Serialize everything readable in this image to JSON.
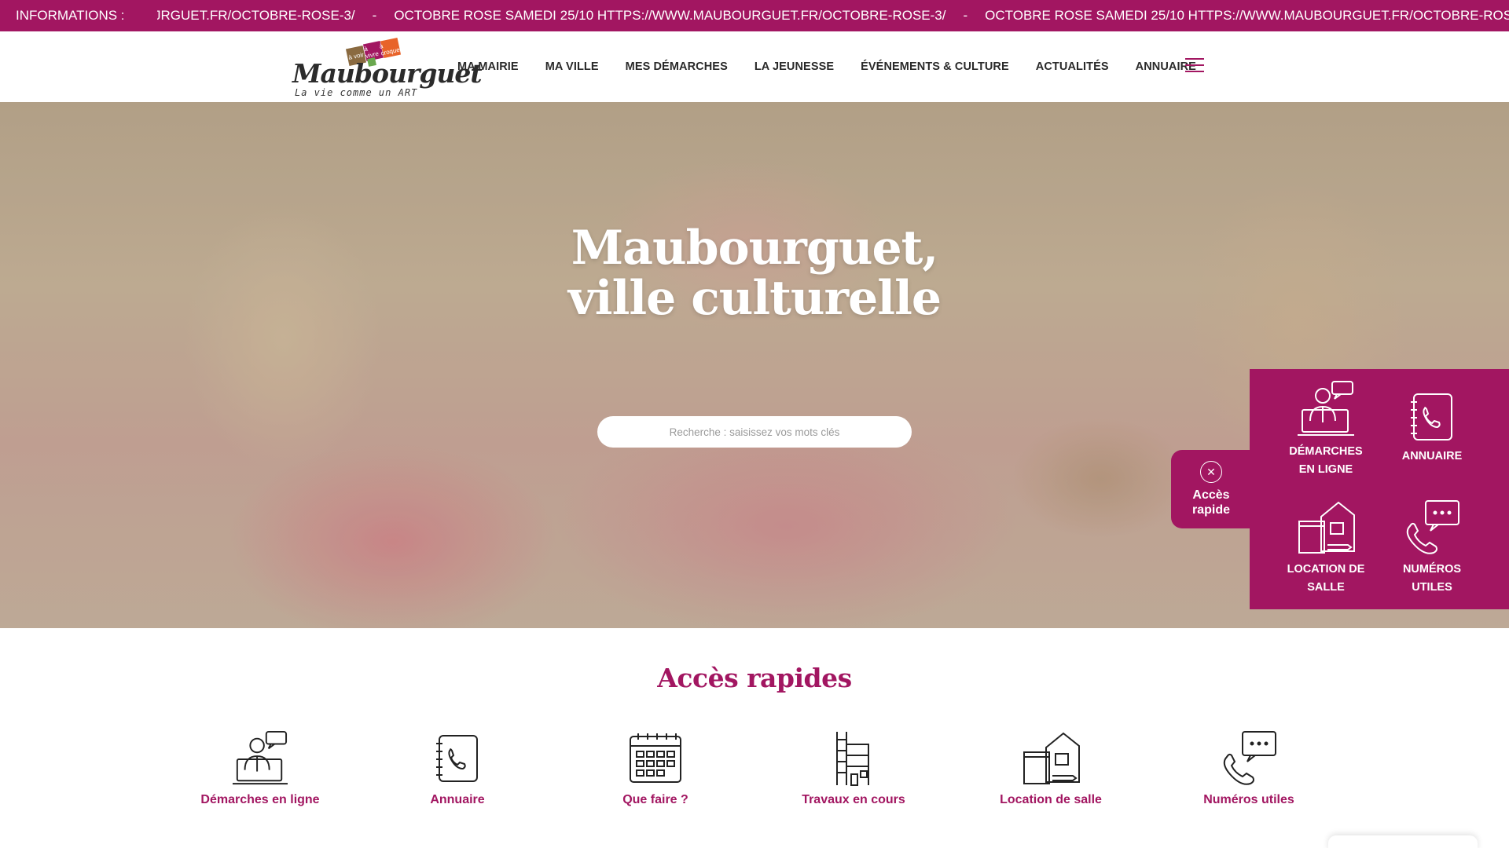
{
  "ticker": {
    "label": "INFORMATIONS :",
    "items": [
      "JRGUET.FR/OCTOBRE-ROSE-3/",
      "OCTOBRE ROSE SAMEDI 25/10 HTTPS://WWW.MAUBOURGUET.FR/OCTOBRE-ROSE-3/",
      "OCTOBRE ROSE SAMEDI 25/10 HTTPS://WWW.MAUBOURGUET.FR/OCTOBRE-ROSE-3/",
      "O"
    ],
    "separator": "-"
  },
  "header": {
    "logo": {
      "word": "Maubourguet",
      "tagline": "La vie comme un ART",
      "badges": [
        "à voir",
        "à vivre",
        "à croquer"
      ]
    },
    "nav": [
      "MA MAIRIE",
      "MA VILLE",
      "MES DÉMARCHES",
      "LA JEUNESSE",
      "ÉVÉNEMENTS & CULTURE",
      "ACTUALITÉS",
      "ANNUAIRE"
    ],
    "menu_icon": "hamburger-icon"
  },
  "hero": {
    "title_line1": "Maubourguet,",
    "title_line2": "ville culturelle",
    "search_placeholder": "Recherche : saisissez vos mots clés"
  },
  "quick_panel": {
    "tab_label_1": "Accès",
    "tab_label_2": "rapide",
    "items": [
      {
        "line1": "DÉMARCHES",
        "line2": "EN LIGNE",
        "icon": "online-procedures-icon"
      },
      {
        "line1": "ANNUAIRE",
        "line2": "",
        "icon": "directory-icon"
      },
      {
        "line1": "LOCATION DE",
        "line2": "SALLE",
        "icon": "room-rental-icon"
      },
      {
        "line1": "NUMÉROS",
        "line2": "UTILES",
        "icon": "useful-numbers-icon"
      }
    ]
  },
  "quick_section": {
    "title": "Accès rapides",
    "items": [
      {
        "label": "Démarches en ligne",
        "icon": "online-procedures-icon"
      },
      {
        "label": "Annuaire",
        "icon": "directory-icon"
      },
      {
        "label": "Que faire ?",
        "icon": "calendar-icon"
      },
      {
        "label": "Travaux en cours",
        "icon": "building-works-icon"
      },
      {
        "label": "Location de salle",
        "icon": "room-rental-icon"
      },
      {
        "label": "Numéros utiles",
        "icon": "useful-numbers-icon"
      }
    ]
  },
  "colors": {
    "brand": "#a21661",
    "text": "#2a2a2a",
    "white": "#ffffff"
  }
}
